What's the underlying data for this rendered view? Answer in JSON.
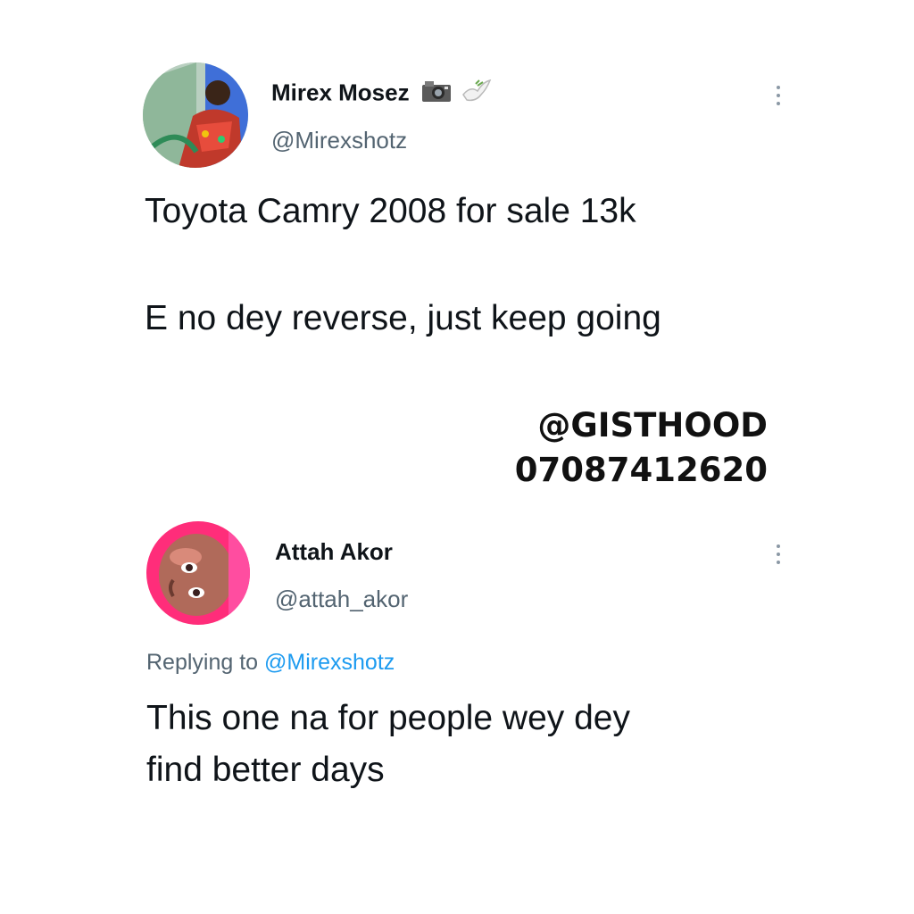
{
  "tweet": {
    "author_name": "Mirex Mosez",
    "author_badges": [
      "camera-icon",
      "dove-icon"
    ],
    "author_handle": "@Mirexshotz",
    "text_line1": "Toyota Camry 2008 for sale 13k",
    "text_line2": "E no dey reverse, just keep going"
  },
  "watermark": {
    "handle": "@GISTHOOD",
    "phone": "07087412620"
  },
  "reply": {
    "author_name": "Attah Akor",
    "author_handle": "@attah_akor",
    "replying_prefix": "Replying to",
    "replying_mention": "@Mirexshotz",
    "text_line1": "This one na for people wey dey",
    "text_line2": "find better days"
  },
  "colors": {
    "text_primary": "#0f1419",
    "text_secondary": "#536471",
    "mention_blue": "#1d9bf0",
    "background": "#ffffff"
  }
}
